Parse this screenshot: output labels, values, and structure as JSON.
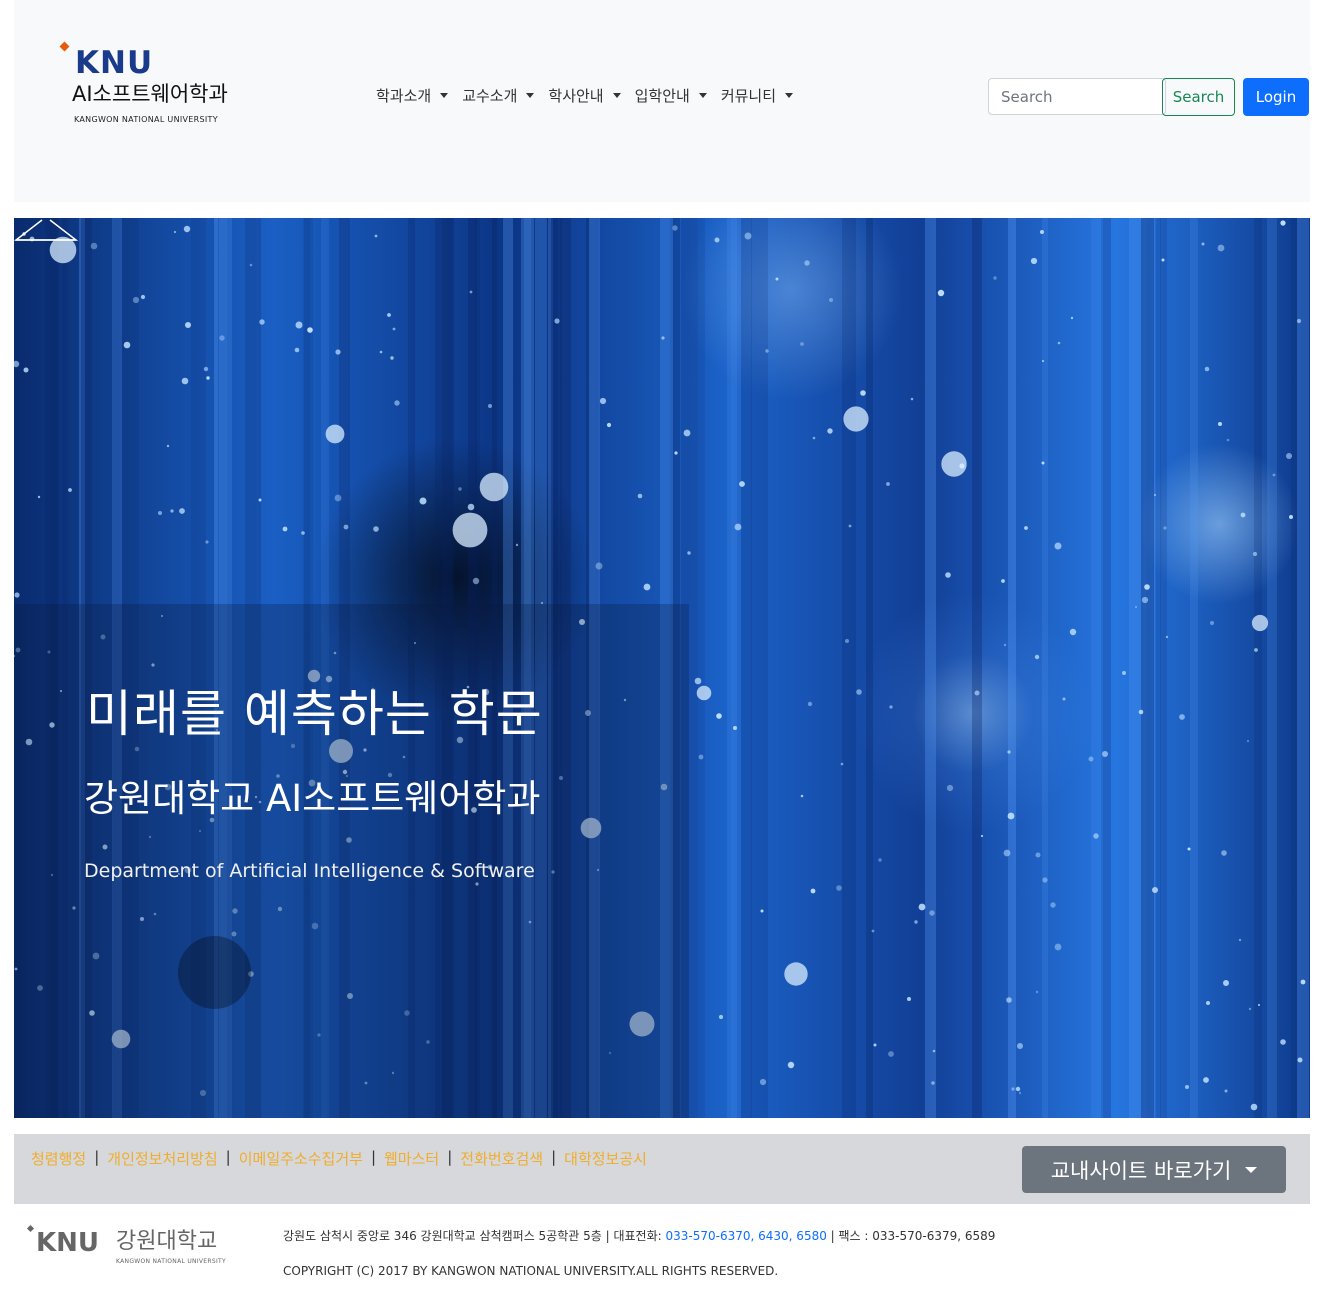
{
  "brand": {
    "logo_text": "KNU",
    "dept_name": "AI소프트웨어학과",
    "univ_name": "KANGWON NATIONAL UNIVERSITY"
  },
  "nav": {
    "items": [
      {
        "label": "학과소개"
      },
      {
        "label": "교수소개"
      },
      {
        "label": "학사안내"
      },
      {
        "label": "입학안내"
      },
      {
        "label": "커뮤니티"
      }
    ],
    "search_placeholder": "Search",
    "search_button": "Search",
    "login_button": "Login"
  },
  "hero": {
    "heading": "미래를 예측하는 학문",
    "subheading": "강원대학교 AI소프트웨어학과",
    "description": "Department of Artificial Intelligence & Software"
  },
  "footer": {
    "links": [
      "청렴행정",
      "개인정보처리방침",
      "이메일주소수집거부",
      "웹마스터",
      "전화번호검색",
      "대학정보공시"
    ],
    "separator": "|",
    "site_dropdown": "교내사이트 바로가기",
    "logo_knu": "KNU",
    "logo_name": "강원대학교",
    "logo_sub": "KANGWON NATIONAL UNIVERSITY",
    "address_prefix": "강원도 삼척시 중앙로 346 강원대학교 삼척캠퍼스 5공학관 5층 | 대표전화: ",
    "phone_numbers": "033-570-6370, 6430, 6580",
    "fax": " | 팩스 : 033-570-6379, 6589",
    "copyright": "COPYRIGHT (C) 2017 BY KANGWON NATIONAL UNIVERSITY.ALL RIGHTS RESERVED."
  },
  "colors": {
    "navbar_bg": "#f8f9fa",
    "primary": "#0d6efd",
    "success": "#198754",
    "footer_link": "#f0ad2e",
    "secondary": "#6c757d"
  }
}
